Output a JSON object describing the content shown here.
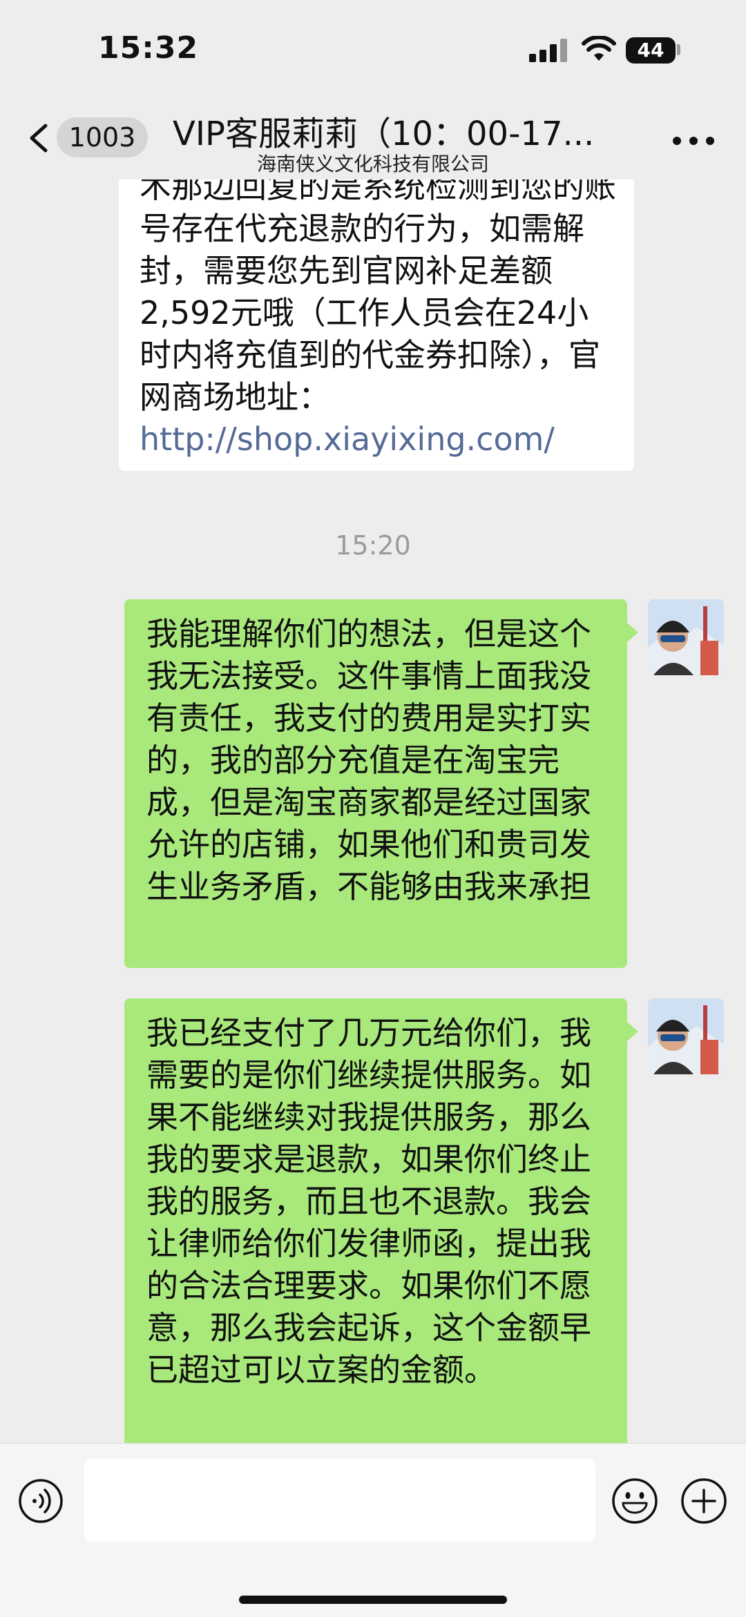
{
  "status_bar": {
    "time": "15:32",
    "battery": "44"
  },
  "nav": {
    "unread_count": "1003",
    "title": "VIP客服莉莉（10：00-17...",
    "subtitle": "海南侠义文化科技有限公司",
    "icons": {
      "back": "chevron-left-icon",
      "more": "more-icon"
    }
  },
  "messages": {
    "incoming": [
      {
        "text": "术那边回复的是系统检测到您的账号存在代充退款的行为，如需解封，需要您先到官网补足差额2,592元哦（工作人员会在24小时内将充值到的代金券扣除），官网商场地址：",
        "link": "http://shop.xiayixing.com/"
      }
    ],
    "timestamp": "15:20",
    "outgoing": [
      {
        "text": "我能理解你们的想法，但是这个我无法接受。这件事情上面我没有责任，我支付的费用是实打实的，我的部分充值是在淘宝完成，但是淘宝商家都是经过国家允许的店铺，如果他们和贵司发生业务矛盾，不能够由我来承担"
      },
      {
        "text": "我已经支付了几万元给你们，我需要的是你们继续提供服务。如果不能继续对我提供服务，那么我的要求是退款，如果你们终止我的服务，而且也不退款。我会让律师给你们发律师函，提出我的合法合理要求。如果你们不愿意，那么我会起诉，这个金额早已超过可以立案的金额。"
      }
    ]
  },
  "input_bar": {
    "icons": {
      "voice": "voice-icon",
      "emoji": "emoji-icon",
      "plus": "plus-icon"
    }
  },
  "colors": {
    "outgoing_bubble": "#a9e97b",
    "incoming_bubble": "#ffffff",
    "background": "#ededed",
    "link": "#556a96"
  }
}
